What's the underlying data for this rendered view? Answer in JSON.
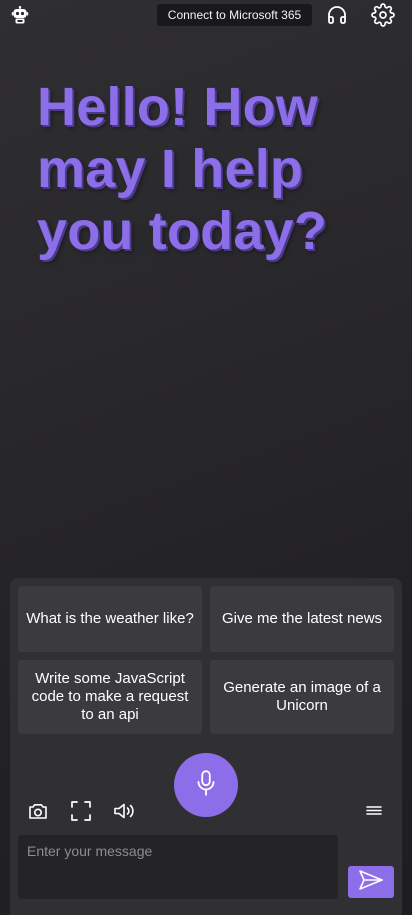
{
  "header": {
    "logo_icon": "robot-logo-icon",
    "connect_label": "Connect to Microsoft 365",
    "headphone_icon": "headphones-icon",
    "settings_icon": "gear-icon"
  },
  "greeting": "Hello! How may I help you today?",
  "suggestions": [
    {
      "label": "What is the weather like?"
    },
    {
      "label": "Give me the latest news"
    },
    {
      "label": "Write some JavaScript code to make a request to an api"
    },
    {
      "label": "Generate an image of a Unicorn"
    }
  ],
  "toolbar": {
    "mic_icon": "microphone-icon",
    "camera_icon": "camera-icon",
    "fullscreen_icon": "fullscreen-icon",
    "speaker_icon": "speaker-icon",
    "menu_icon": "menu-icon"
  },
  "composer": {
    "placeholder": "Enter your message",
    "send_icon": "send-icon"
  },
  "colors": {
    "accent": "#8b6ee8",
    "panel": "#303034",
    "suggestion_bg": "#3b3b3f",
    "input_bg": "#242427"
  }
}
